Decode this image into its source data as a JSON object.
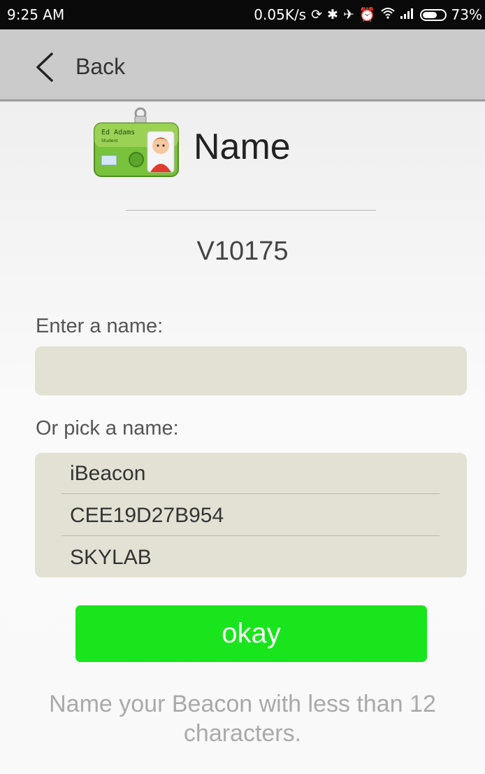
{
  "status_bar": {
    "time": "9:25 AM",
    "network_speed": "0.05K/s",
    "battery_percent": "73%",
    "battery_level": 0.73,
    "icons": [
      "sync-icon",
      "bluetooth-icon",
      "vibrate-off-icon",
      "alarm-icon",
      "wifi-icon",
      "signal-icon",
      "battery-icon"
    ]
  },
  "nav": {
    "back_label": "Back"
  },
  "header": {
    "title": "Name",
    "icon": "id-badge-icon",
    "badge_name": "Ed Adams",
    "badge_role": "Student"
  },
  "device_id": "V10175",
  "form": {
    "enter_label": "Enter a name:",
    "name_value": "",
    "pick_label": "Or pick a name:",
    "options": [
      "iBeacon",
      "CEE19D27B954",
      "SKYLAB"
    ]
  },
  "okay_label": "okay",
  "hint": "Name your Beacon with less than 12 characters.",
  "colors": {
    "status_bar": "#0a0a0a",
    "nav_bar": "#cbcbcb",
    "field_background": "#e2e1d4",
    "okay_button": "#19e51c",
    "hint_text": "#a9a9a9"
  }
}
